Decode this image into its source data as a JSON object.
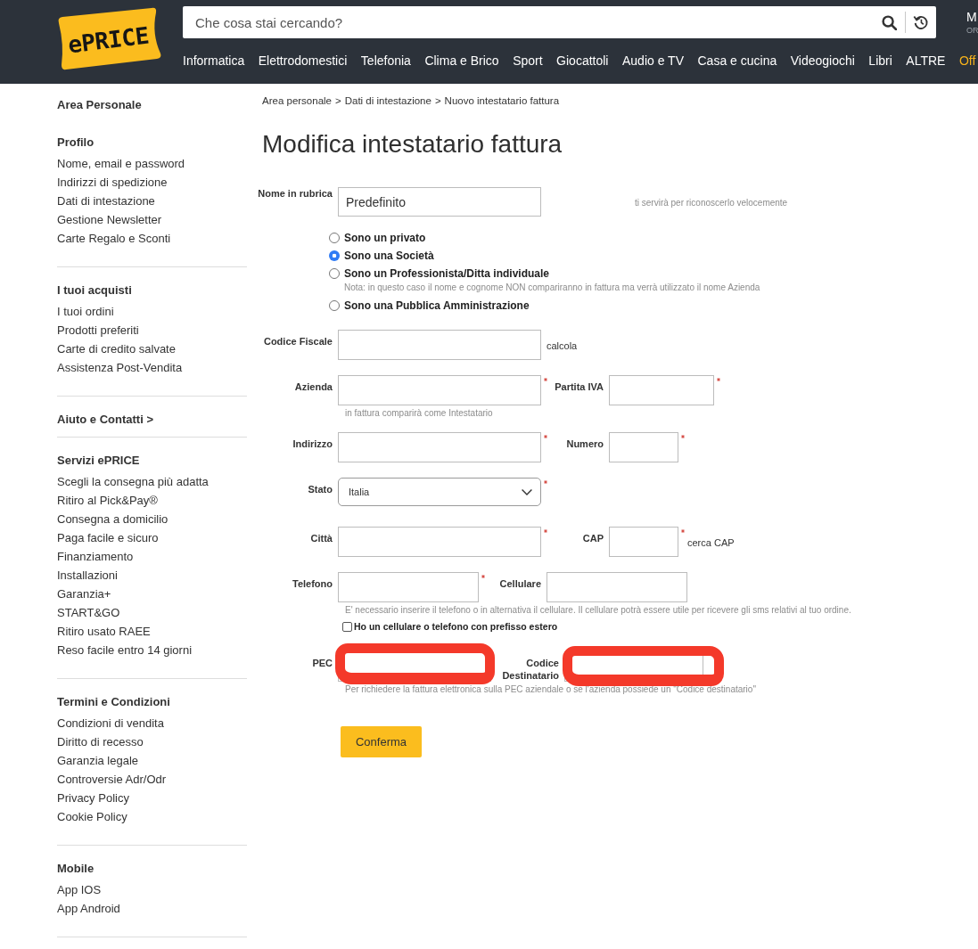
{
  "header": {
    "logo": "ePRICE",
    "search": {
      "placeholder": "Che cosa stai cercando?"
    },
    "account": {
      "name": "M",
      "caption": "OR"
    },
    "nav": [
      {
        "label": "Informatica",
        "highlighted": false
      },
      {
        "label": "Elettrodomestici",
        "highlighted": false
      },
      {
        "label": "Telefonia",
        "highlighted": false
      },
      {
        "label": "Clima e Brico",
        "highlighted": false
      },
      {
        "label": "Sport",
        "highlighted": false
      },
      {
        "label": "Giocattoli",
        "highlighted": false
      },
      {
        "label": "Audio e TV",
        "highlighted": false
      },
      {
        "label": "Casa e cucina",
        "highlighted": false
      },
      {
        "label": "Videogiochi",
        "highlighted": false
      },
      {
        "label": "Libri",
        "highlighted": false
      },
      {
        "label": "ALTRE",
        "highlighted": false
      },
      {
        "label": "Off",
        "highlighted": true
      }
    ]
  },
  "sidebar": {
    "title": "Area Personale",
    "sections": [
      {
        "heading": "Profilo",
        "items": [
          "Nome, email e password",
          "Indirizzi di spedizione",
          "Dati di intestazione",
          "Gestione Newsletter",
          "Carte Regalo e Sconti"
        ]
      },
      {
        "heading": "I tuoi acquisti",
        "items": [
          "I tuoi ordini",
          "Prodotti preferiti",
          "Carte di credito salvate",
          "Assistenza Post-Vendita"
        ]
      },
      {
        "heading": "Aiuto e Contatti >"
      },
      {
        "heading": "Servizi ePRICE",
        "items": [
          "Scegli la consegna più adatta",
          "Ritiro al Pick&Pay®",
          "Consegna a domicilio",
          "Paga facile e sicuro",
          "Finanziamento",
          "Installazioni",
          "Garanzia+",
          "START&GO",
          "Ritiro usato RAEE",
          "Reso facile entro 14 giorni"
        ]
      },
      {
        "heading": "Termini e Condizioni",
        "items": [
          "Condizioni di vendita",
          "Diritto di recesso",
          "Garanzia legale",
          "Controversie Adr/Odr",
          "Privacy Policy",
          "Cookie Policy"
        ]
      },
      {
        "heading": "Mobile",
        "items": [
          "App IOS",
          "App Android"
        ]
      }
    ]
  },
  "breadcrumb": {
    "separator": ">",
    "items": [
      "Area personale",
      "Dati di intestazione",
      "Nuovo intestatario fattura"
    ]
  },
  "title": "Modifica intestatario fattura",
  "form": {
    "name_field": {
      "label": "Nome in rubrica",
      "value": "Predefinito",
      "hint": "ti servirà per riconoscerlo velocemente"
    },
    "customer_type": [
      {
        "label": "Sono un privato",
        "selected": false
      },
      {
        "label": "Sono una Società",
        "selected": true
      },
      {
        "label": "Sono un Professionista/Ditta individuale",
        "selected": false,
        "note": "Nota: in questo caso il nome e cognome NON compariranno in fattura ma verrà utilizzato il nome Azienda"
      },
      {
        "label": "Sono una Pubblica Amministrazione",
        "selected": false
      }
    ],
    "rows": [
      {
        "fields": [
          {
            "kind": "input",
            "label": "Codice Fiscale",
            "required": false,
            "redacted": false,
            "action": "calcola"
          }
        ]
      },
      {
        "fields": [
          {
            "kind": "input",
            "label": "Azienda",
            "required": true,
            "redacted": false
          },
          {
            "kind": "input",
            "label": "Partita IVA",
            "required": true,
            "redacted": false
          }
        ],
        "hint": "in fattura comparirà come Intestatario"
      },
      {
        "fields": [
          {
            "kind": "input",
            "label": "Indirizzo",
            "required": true,
            "redacted": false
          },
          {
            "kind": "input",
            "label": "Numero",
            "required": true,
            "redacted": false
          }
        ]
      },
      {
        "fields": [
          {
            "kind": "select",
            "label": "Stato",
            "value": "Italia",
            "required": true,
            "redacted": false
          }
        ]
      },
      {
        "fields": [
          {
            "kind": "input",
            "label": "Città",
            "required": true,
            "redacted": false
          },
          {
            "kind": "input",
            "label": "CAP",
            "required": true,
            "redacted": false,
            "action": "cerca CAP"
          }
        ]
      },
      {
        "fields": [
          {
            "kind": "input",
            "label": "Telefono",
            "required": true,
            "redacted": false
          },
          {
            "kind": "input",
            "label": "Cellulare",
            "required": false,
            "redacted": false
          }
        ],
        "hint": "E' necessario inserire il telefono o in alternativa il cellulare. Il cellulare potrà essere utile per ricevere gli sms relativi al tuo ordine.",
        "checkbox": {
          "label": "Ho un cellulare o telefono con prefisso estero",
          "checked": false
        }
      },
      {
        "fields": [
          {
            "kind": "input",
            "label": "PEC",
            "required": false,
            "redacted": true
          },
          {
            "kind": "input",
            "label": "Codice Destinatario",
            "required": false,
            "redacted": true
          }
        ],
        "hint": "Per richiedere la fattura elettronica sulla PEC aziendale o se l'azienda possiede un \"Codice destinatario\""
      }
    ],
    "submit": "Conferma"
  }
}
